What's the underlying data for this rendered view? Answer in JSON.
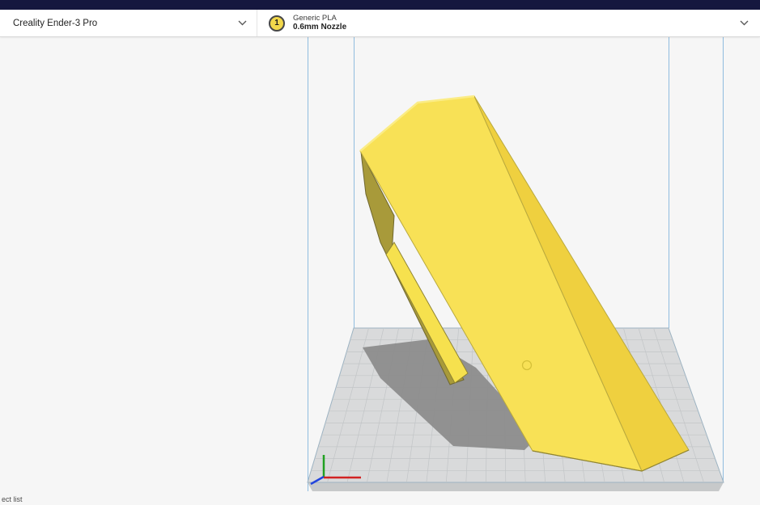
{
  "header": {
    "printer_selector": {
      "value": "Creality Ender-3 Pro"
    },
    "material_selector": {
      "extruder_number": "1",
      "material_name": "Generic PLA",
      "nozzle_size": "0.6mm Nozzle"
    }
  },
  "viewport": {
    "object_list_label": "ect list"
  },
  "colors": {
    "header_navy": "#15173F",
    "model_yellow_bright": "#F8E156",
    "model_yellow_side": "#EFD03F",
    "model_yellow_dark": "#A89A3A",
    "build_volume_blue": "#8FBCDF",
    "plate_gray": "#D9DADB",
    "shadow_gray": "#8B8B8B",
    "axis_x_red": "#D22222",
    "axis_z_green": "#21A121",
    "axis_y_blue": "#2244DD"
  }
}
